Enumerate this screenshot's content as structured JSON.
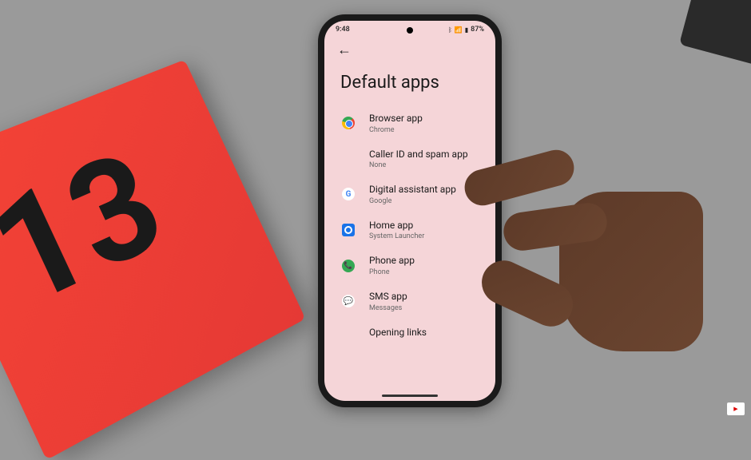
{
  "status_bar": {
    "time": "9:48",
    "battery": "87%"
  },
  "page": {
    "title": "Default apps"
  },
  "settings": [
    {
      "title": "Browser app",
      "subtitle": "Chrome",
      "icon": "chrome"
    },
    {
      "title": "Caller ID and spam app",
      "subtitle": "None",
      "icon": null
    },
    {
      "title": "Digital assistant app",
      "subtitle": "Google",
      "icon": "google"
    },
    {
      "title": "Home app",
      "subtitle": "System Launcher",
      "icon": "home"
    },
    {
      "title": "Phone app",
      "subtitle": "Phone",
      "icon": "phone"
    },
    {
      "title": "SMS app",
      "subtitle": "Messages",
      "icon": "sms"
    },
    {
      "title": "Opening links",
      "subtitle": null,
      "icon": null
    }
  ],
  "box_number": "13"
}
